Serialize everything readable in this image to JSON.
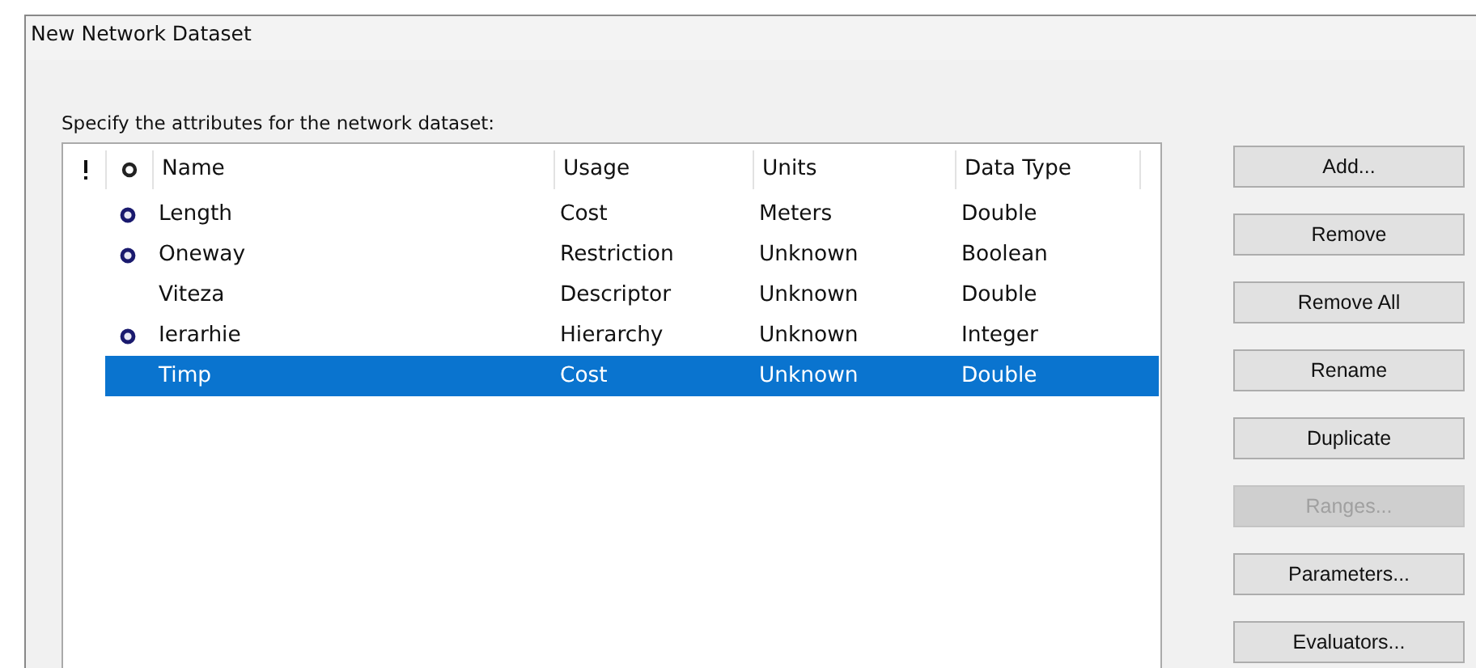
{
  "window": {
    "title": "New Network Dataset"
  },
  "prompt": "Specify the attributes for the network dataset:",
  "table": {
    "columns": [
      "Name",
      "Usage",
      "Units",
      "Data Type"
    ],
    "rows": [
      {
        "default": true,
        "selected": false,
        "cells": [
          "Length",
          "Cost",
          "Meters",
          "Double"
        ]
      },
      {
        "default": true,
        "selected": false,
        "cells": [
          "Oneway",
          "Restriction",
          "Unknown",
          "Boolean"
        ]
      },
      {
        "default": false,
        "selected": false,
        "cells": [
          "Viteza",
          "Descriptor",
          "Unknown",
          "Double"
        ]
      },
      {
        "default": true,
        "selected": false,
        "cells": [
          "Ierarhie",
          "Hierarchy",
          "Unknown",
          "Integer"
        ]
      },
      {
        "default": false,
        "selected": true,
        "cells": [
          "Timp",
          "Cost",
          "Unknown",
          "Double"
        ]
      }
    ]
  },
  "buttons": [
    {
      "label": "Add...",
      "disabled": false
    },
    {
      "label": "Remove",
      "disabled": false
    },
    {
      "label": "Remove All",
      "disabled": false
    },
    {
      "label": "Rename",
      "disabled": false
    },
    {
      "label": "Duplicate",
      "disabled": false
    },
    {
      "label": "Ranges...",
      "disabled": true
    },
    {
      "label": "Parameters...",
      "disabled": false
    },
    {
      "label": "Evaluators...",
      "disabled": false
    }
  ]
}
